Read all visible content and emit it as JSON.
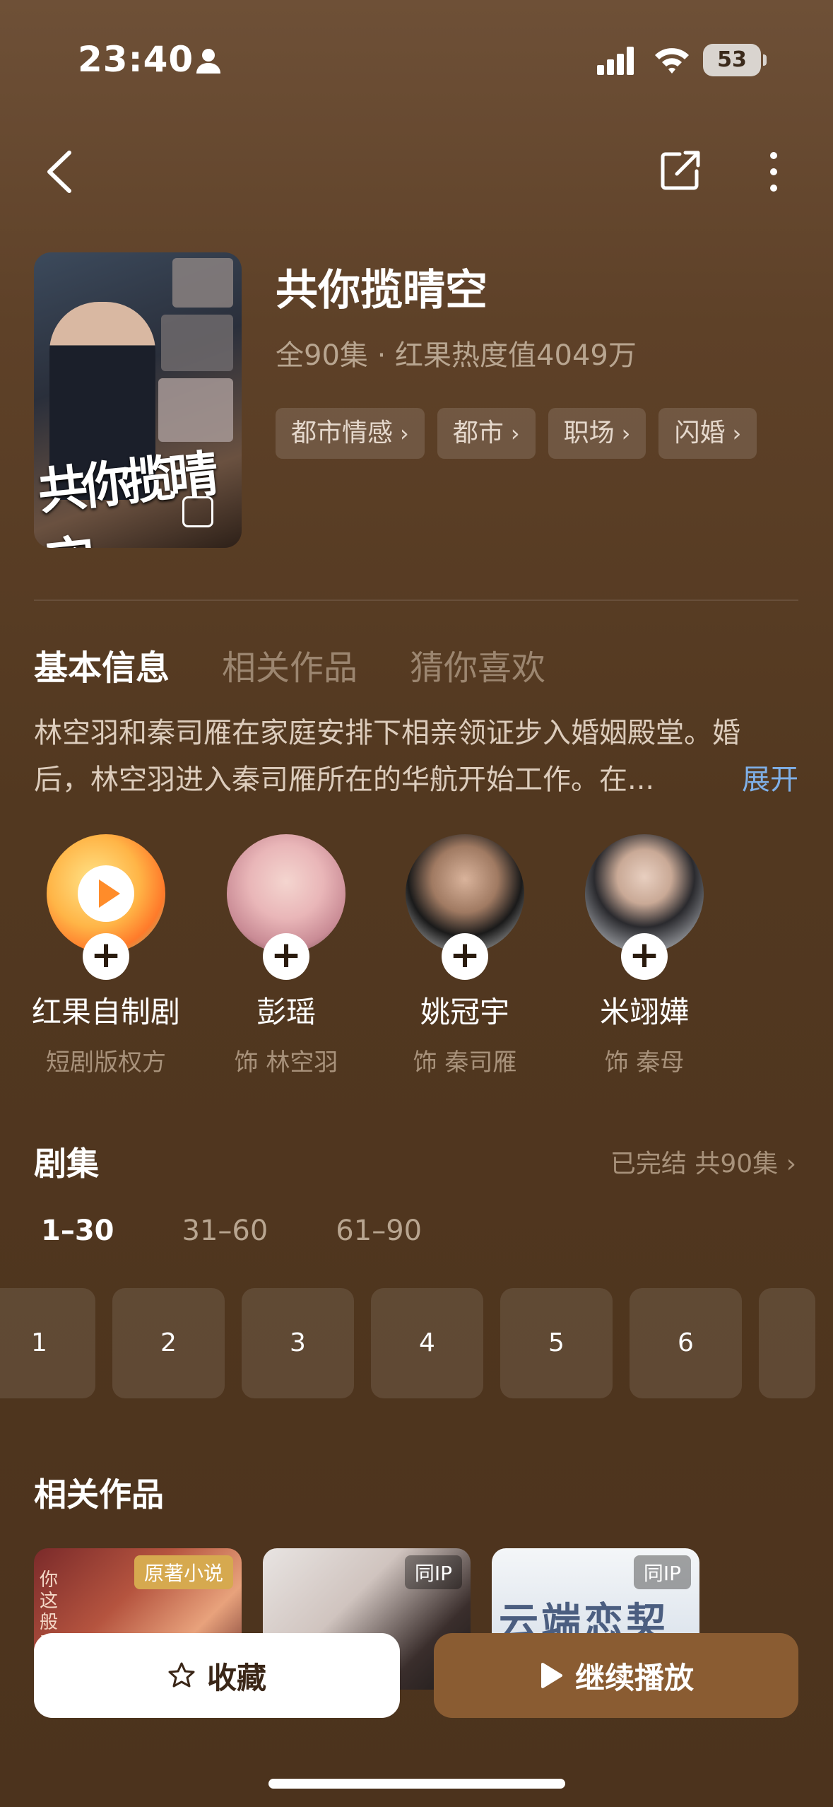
{
  "status_bar": {
    "time": "23:40",
    "battery": "53"
  },
  "show": {
    "title": "共你揽晴空",
    "poster_title": "共你揽晴空",
    "meta": "全90集 · 红果热度值4049万",
    "tags": [
      "都市情感",
      "都市",
      "职场",
      "闪婚"
    ]
  },
  "tabs": [
    "基本信息",
    "相关作品",
    "猜你喜欢"
  ],
  "description": {
    "line1": "林空羽和秦司雁在家庭安排下相亲领证步入婚姻殿堂。婚",
    "line2": "后，林空羽进入秦司雁所在的华航开始工作。在...",
    "expand": "展开"
  },
  "people": [
    {
      "name": "红果自制剧",
      "role": "短剧版权方"
    },
    {
      "name": "彭瑶",
      "role": "饰 林空羽"
    },
    {
      "name": "姚冠宇",
      "role": "饰 秦司雁"
    },
    {
      "name": "米翊嬅",
      "role": "饰 秦母"
    }
  ],
  "episodes": {
    "title": "剧集",
    "status": "已完结 共90集",
    "ranges": [
      "1–30",
      "31–60",
      "61–90"
    ],
    "items": [
      "1",
      "2",
      "3",
      "4",
      "5",
      "6"
    ]
  },
  "related": {
    "title": "相关作品",
    "items": [
      {
        "badge": "原著小说",
        "cover_text": "你这般动人"
      },
      {
        "badge": "同IP"
      },
      {
        "badge": "同IP",
        "cover_text": "云端恋契"
      }
    ]
  },
  "actions": {
    "favorite": "收藏",
    "continue": "继续播放"
  },
  "colors": {
    "accent": "#8a5c32",
    "link": "#7fb0e8",
    "background": "#523820"
  }
}
